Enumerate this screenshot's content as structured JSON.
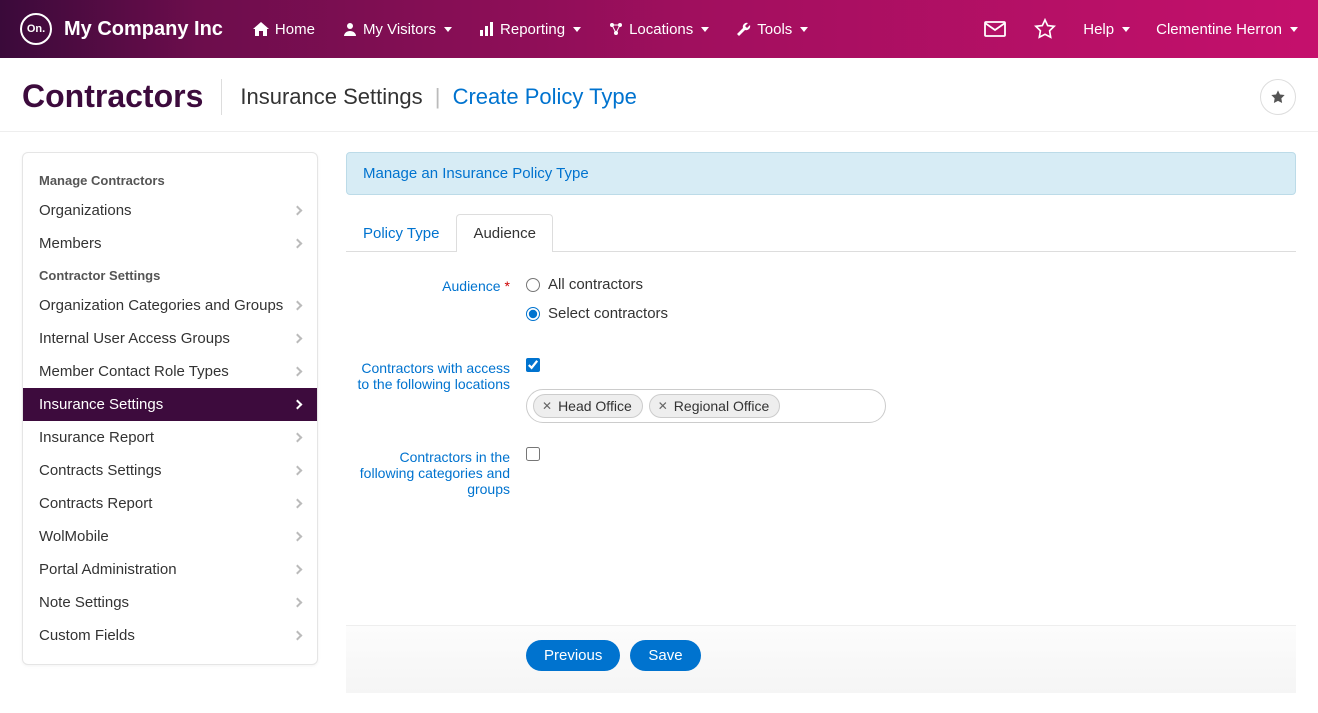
{
  "brand": {
    "logo_text": "On.",
    "company": "My Company Inc"
  },
  "nav": {
    "home": "Home",
    "visitors": "My Visitors",
    "reporting": "Reporting",
    "locations": "Locations",
    "tools": "Tools",
    "help": "Help",
    "user": "Clementine Herron"
  },
  "header": {
    "title": "Contractors",
    "subtitle": "Insurance Settings",
    "breadcrumb_link": "Create Policy Type"
  },
  "sidebar": {
    "section1_title": "Manage Contractors",
    "section1": [
      "Organizations",
      "Members"
    ],
    "section2_title": "Contractor Settings",
    "section2": [
      "Organization Categories and Groups",
      "Internal User Access Groups",
      "Member Contact Role Types",
      "Insurance Settings",
      "Insurance Report",
      "Contracts Settings",
      "Contracts Report",
      "WolMobile",
      "Portal Administration",
      "Note Settings",
      "Custom Fields"
    ],
    "active": "Insurance Settings"
  },
  "main": {
    "banner": "Manage an Insurance Policy Type",
    "tabs": {
      "policy": "Policy Type",
      "audience": "Audience"
    },
    "form": {
      "audience_label": "Audience",
      "radio_all": "All contractors",
      "radio_select": "Select contractors",
      "locations_label": "Contractors with access to the following locations",
      "locations_checked": true,
      "tags": [
        "Head Office",
        "Regional Office"
      ],
      "categories_label": "Contractors in the following categories and groups",
      "categories_checked": false
    },
    "buttons": {
      "prev": "Previous",
      "save": "Save"
    }
  }
}
